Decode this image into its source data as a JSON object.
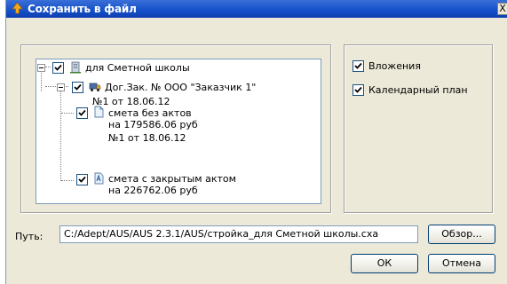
{
  "window": {
    "title": "Сохранить в файл",
    "close_glyph": "X"
  },
  "tree": {
    "root": {
      "label": "для Сметной школы",
      "checked": true,
      "icon": "building-icon"
    },
    "contract": {
      "label": "Дог.Зак. № ООО \"Заказчик 1\"",
      "checked": true,
      "icon": "truck-icon"
    },
    "estimate1": {
      "lines": [
        "№1 от 18.06.12",
        "смета без актов",
        "на 179586.06 руб"
      ],
      "checked": true,
      "icon": "document-icon"
    },
    "estimate2": {
      "lines": [
        "№1 от 18.06.12",
        "смета с закрытым актом",
        "на 226762.06 руб"
      ],
      "checked": true,
      "icon": "document-act-icon"
    }
  },
  "options": [
    {
      "label": "Вложения",
      "checked": true
    },
    {
      "label": "Календарный план",
      "checked": true
    }
  ],
  "path": {
    "label": "Путь:",
    "value": "C:/Adept/AUS/AUS 2.3.1/AUS/стройка_для Сметной школы.cxa"
  },
  "buttons": {
    "browse": "Обзор...",
    "ok": "ОК",
    "cancel": "Отмена"
  }
}
